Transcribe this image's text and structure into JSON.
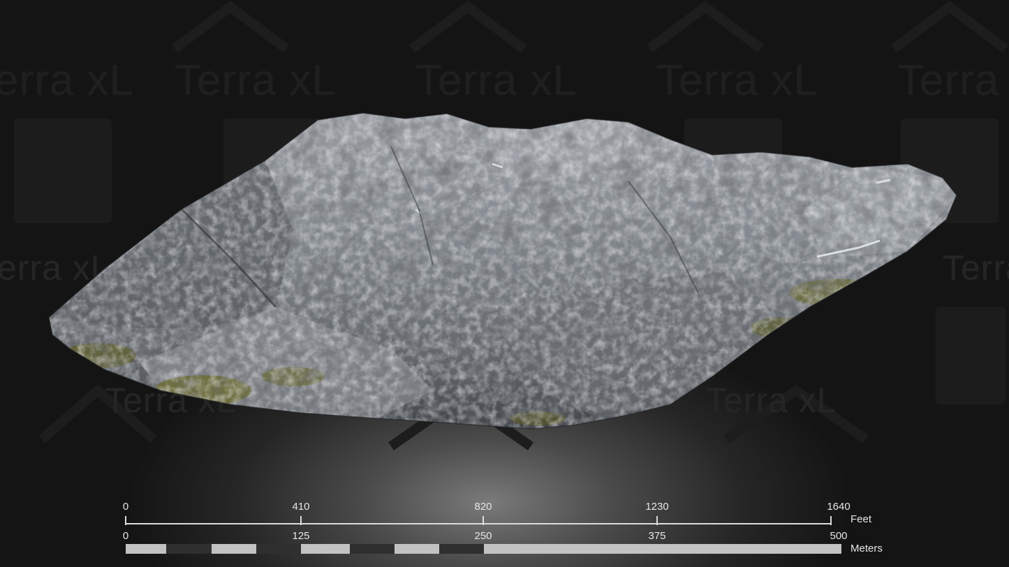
{
  "watermark": {
    "brand": "Terra xL"
  },
  "scale_bar": {
    "feet": {
      "unit": "Feet",
      "ticks": [
        "0",
        "410",
        "820",
        "1230",
        "1640"
      ]
    },
    "meters": {
      "unit": "Meters",
      "ticks": [
        "0",
        "125",
        "250",
        "375",
        "500"
      ]
    }
  },
  "colors": {
    "rock_light": "#b9bcc0",
    "rock_mid": "#8a8e94",
    "rock_dark": "#3e4247",
    "moss": "#6b6a2a",
    "scale_text": "#e6e6e6"
  }
}
